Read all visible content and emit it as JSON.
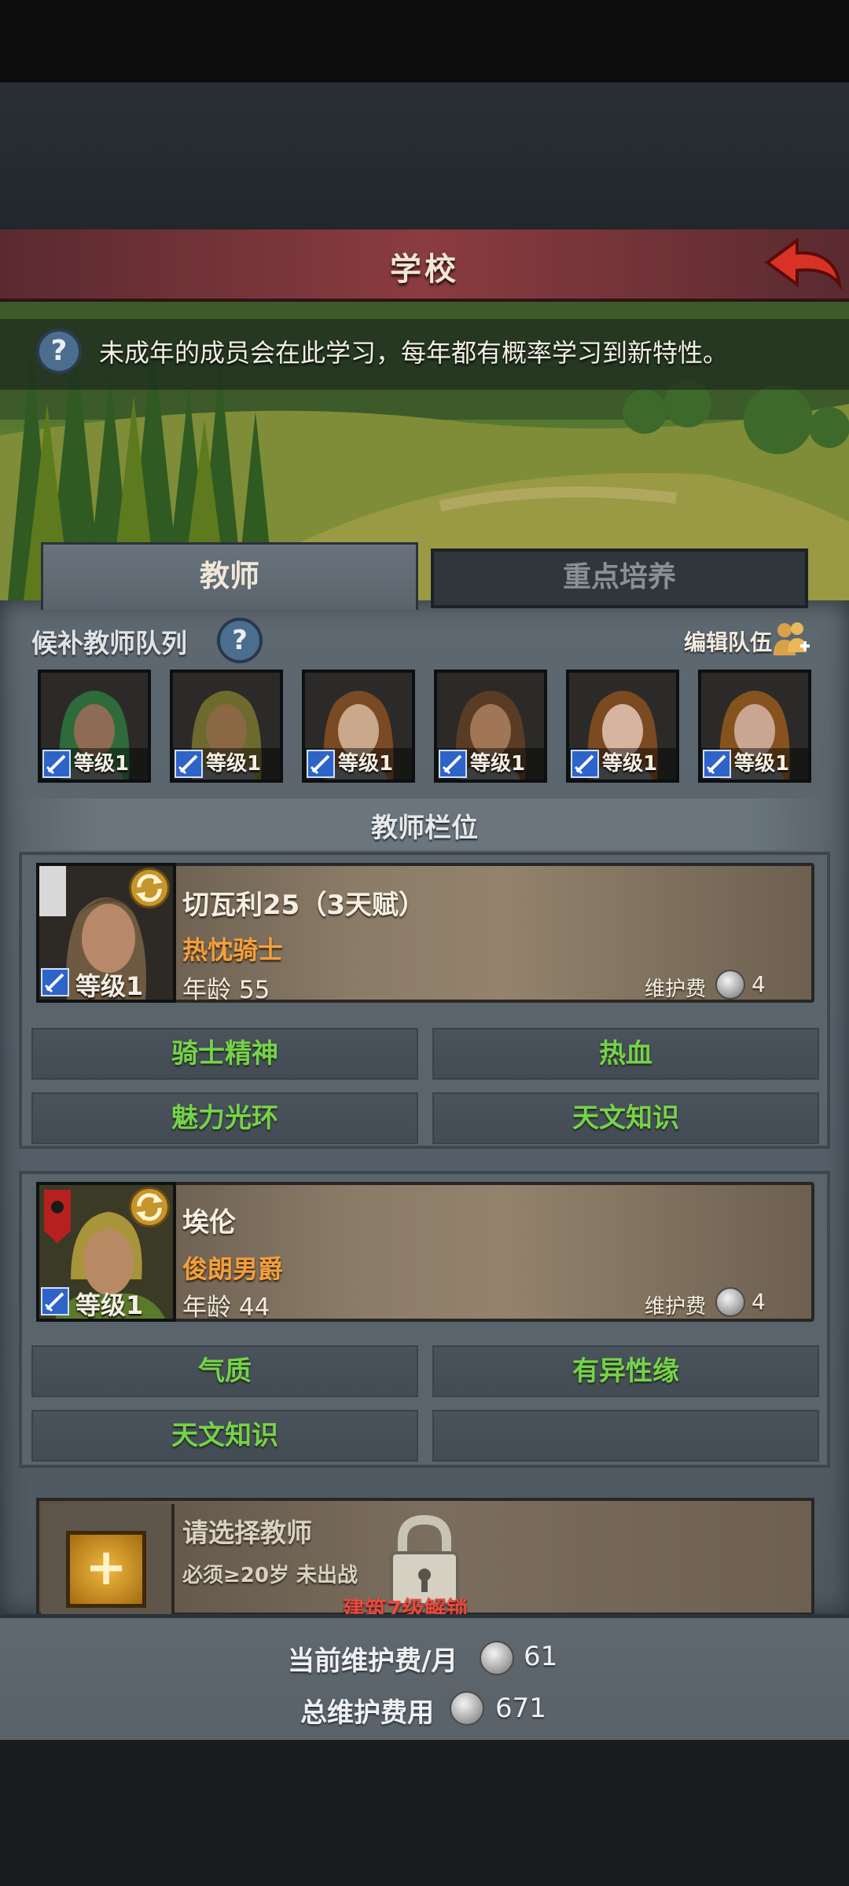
{
  "header": {
    "title": "学校"
  },
  "info": {
    "text": "未成年的成员会在此学习，每年都有概率学习到新特性。"
  },
  "tabs": [
    {
      "label": "教师"
    },
    {
      "label": "重点培养"
    }
  ],
  "candidates": {
    "section_label": "候补教师队列",
    "edit_label": "编辑队伍",
    "items": [
      {
        "level": "等级1",
        "hair": "#2f6a3a",
        "skin": "#8d6b55"
      },
      {
        "level": "等级1",
        "hair": "#6e6a2e",
        "skin": "#8a6844"
      },
      {
        "level": "等级1",
        "hair": "#7a4a24",
        "skin": "#c9a88c"
      },
      {
        "level": "等级1",
        "hair": "#5a3c24",
        "skin": "#a07656"
      },
      {
        "level": "等级1",
        "hair": "#7a4a20",
        "skin": "#d6b4a0"
      },
      {
        "level": "等级1",
        "hair": "#86521e",
        "skin": "#c9a692"
      }
    ]
  },
  "slots": {
    "title": "教师栏位",
    "teachers": [
      {
        "name": "切瓦利25（3天赋）",
        "title": "热忱骑士",
        "age": "年龄 55",
        "level": "等级1",
        "fee_label": "维护费",
        "fee": "4",
        "traits": [
          "骑士精神",
          "热血",
          "魅力光环",
          "天文知识"
        ]
      },
      {
        "name": "埃伦",
        "title": "俊朗男爵",
        "age": "年龄 44",
        "level": "等级1",
        "fee_label": "维护费",
        "fee": "4",
        "traits": [
          "气质",
          "有异性缘",
          "天文知识",
          ""
        ]
      }
    ],
    "empty": {
      "title": "请选择教师",
      "requirement": "必须≥20岁 未出战",
      "unlock": "建筑7级解锁"
    }
  },
  "footer": {
    "monthly_label": "当前维护费/月",
    "monthly_value": "61",
    "total_label": "总维护费用",
    "total_value": "671"
  },
  "colors": {
    "trait_green": "#76d24a",
    "title_orange": "#f2a03c",
    "unlock_red": "#e54a3e"
  }
}
